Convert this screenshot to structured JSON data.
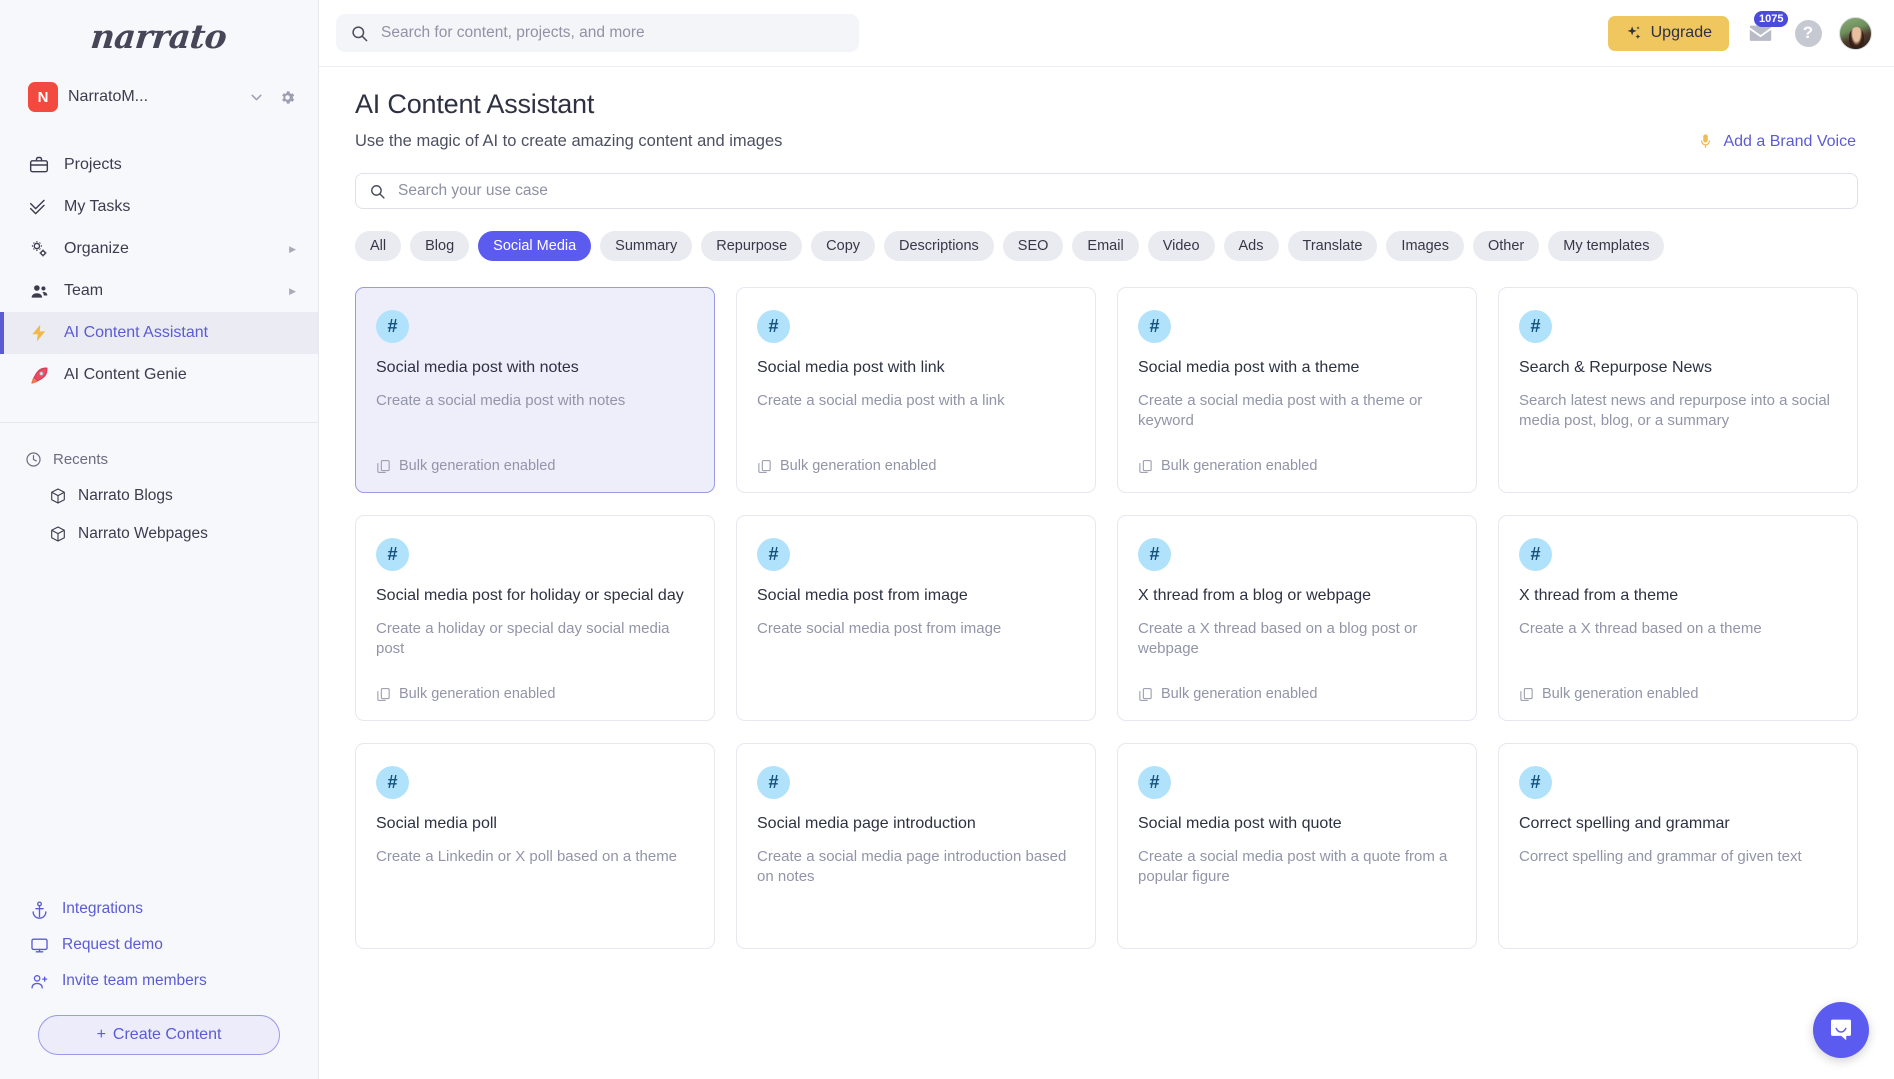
{
  "sidebar": {
    "logo": "narrato",
    "workspace": {
      "initial": "N",
      "name": "NarratoM..."
    },
    "nav": [
      {
        "label": "Projects",
        "icon": "briefcase-icon",
        "caret": ""
      },
      {
        "label": "My Tasks",
        "icon": "check-double-icon",
        "caret": ""
      },
      {
        "label": "Organize",
        "icon": "gears-icon",
        "caret": "▶"
      },
      {
        "label": "Team",
        "icon": "team-icon",
        "caret": "▶"
      },
      {
        "label": "AI Content Assistant",
        "icon": "bolt-icon",
        "caret": ""
      },
      {
        "label": "AI Content Genie",
        "icon": "rocket-icon",
        "caret": ""
      }
    ],
    "recents": {
      "label": "Recents",
      "items": [
        {
          "label": "Narrato Blogs",
          "icon": "cube-icon"
        },
        {
          "label": "Narrato Webpages",
          "icon": "cube-icon"
        }
      ]
    },
    "bottom_links": [
      {
        "label": "Integrations",
        "icon": "anchor-icon"
      },
      {
        "label": "Request demo",
        "icon": "monitor-icon"
      },
      {
        "label": "Invite team members",
        "icon": "user-plus-icon"
      }
    ],
    "create_button": "Create Content",
    "create_button_plus": "+"
  },
  "topbar": {
    "search_placeholder": "Search for content, projects, and more",
    "upgrade_label": "Upgrade",
    "mail_badge": "1075",
    "help_label": "?"
  },
  "page": {
    "title": "AI Content Assistant",
    "subtitle": "Use the magic of AI to create amazing content and images",
    "brand_voice_label": "Add a Brand Voice",
    "usecase_search_placeholder": "Search your use case"
  },
  "chips": [
    {
      "label": "All",
      "active": false
    },
    {
      "label": "Blog",
      "active": false
    },
    {
      "label": "Social Media",
      "active": true
    },
    {
      "label": "Summary",
      "active": false
    },
    {
      "label": "Repurpose",
      "active": false
    },
    {
      "label": "Copy",
      "active": false
    },
    {
      "label": "Descriptions",
      "active": false
    },
    {
      "label": "SEO",
      "active": false
    },
    {
      "label": "Email",
      "active": false
    },
    {
      "label": "Video",
      "active": false
    },
    {
      "label": "Ads",
      "active": false
    },
    {
      "label": "Translate",
      "active": false
    },
    {
      "label": "Images",
      "active": false
    },
    {
      "label": "Other",
      "active": false
    },
    {
      "label": "My templates",
      "active": false
    }
  ],
  "bulk_label": "Bulk generation enabled",
  "cards": [
    {
      "icon": "#",
      "title": "Social media post with notes",
      "desc": "Create a social media post with notes",
      "bulk": true,
      "selected": true
    },
    {
      "icon": "#",
      "title": "Social media post with link",
      "desc": "Create a social media post with a link",
      "bulk": true,
      "selected": false
    },
    {
      "icon": "#",
      "title": "Social media post with a theme",
      "desc": "Create a social media post with a theme or keyword",
      "bulk": true,
      "selected": false
    },
    {
      "icon": "#",
      "title": "Search & Repurpose News",
      "desc": "Search latest news and repurpose into a social media post, blog, or a summary",
      "bulk": false,
      "selected": false
    },
    {
      "icon": "#",
      "title": "Social media post for holiday or special day",
      "desc": "Create a holiday or special day social media post",
      "bulk": true,
      "selected": false
    },
    {
      "icon": "#",
      "title": "Social media post from image",
      "desc": "Create social media post from image",
      "bulk": false,
      "selected": false
    },
    {
      "icon": "#",
      "title": "X thread from a blog or webpage",
      "desc": "Create a X thread based on a blog post or webpage",
      "bulk": true,
      "selected": false
    },
    {
      "icon": "#",
      "title": "X thread from a theme",
      "desc": "Create a X thread based on a theme",
      "bulk": true,
      "selected": false
    },
    {
      "icon": "#",
      "title": "Social media poll",
      "desc": "Create a Linkedin or X poll based on a theme",
      "bulk": false,
      "selected": false
    },
    {
      "icon": "#",
      "title": "Social media page introduction",
      "desc": "Create a social media page introduction based on notes",
      "bulk": false,
      "selected": false
    },
    {
      "icon": "#",
      "title": "Social media post with quote",
      "desc": "Create a social media post with a quote from a popular figure",
      "bulk": false,
      "selected": false
    },
    {
      "icon": "#",
      "title": "Correct spelling and grammar",
      "desc": "Correct spelling and grammar of given text",
      "bulk": false,
      "selected": false
    }
  ],
  "colors": {
    "accent": "#5b5bd6",
    "chip_active": "#5b5bf0",
    "upgrade": "#f0c75e",
    "card_icon_bg": "#b1e2fb",
    "workspace_avatar": "#f4493e"
  }
}
